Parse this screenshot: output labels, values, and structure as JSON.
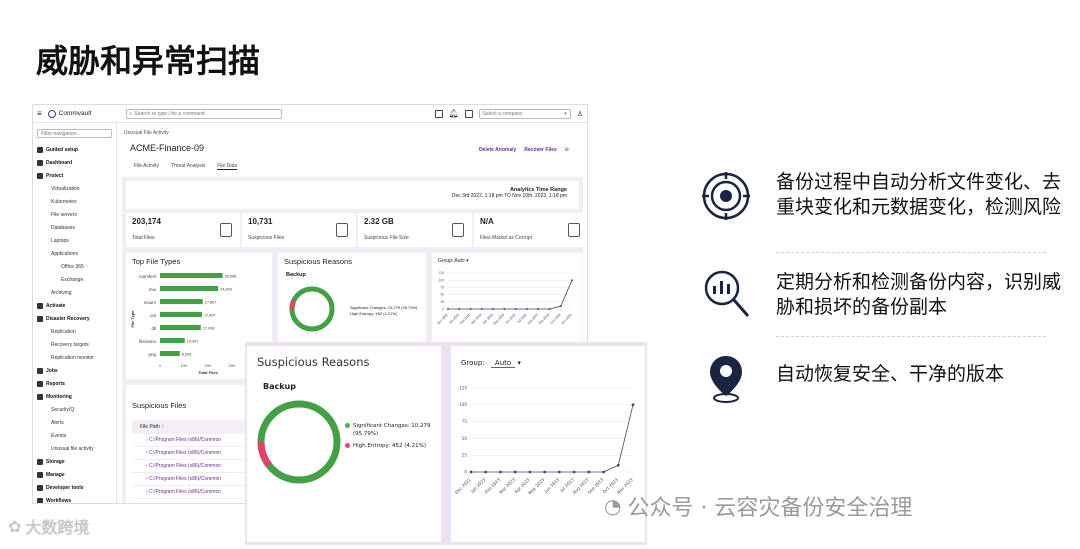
{
  "slide": {
    "title": "威胁和异常扫描"
  },
  "app": {
    "brand": "Commvault",
    "search_placeholder": "Search or type / for a command",
    "company_placeholder": "Select a company",
    "filter_placeholder": "Filter navigation...",
    "nav": [
      {
        "label": "Guided setup",
        "level": 0
      },
      {
        "label": "Dashboard",
        "level": 0
      },
      {
        "label": "Protect",
        "level": 0
      },
      {
        "label": "Virtualization",
        "level": 1
      },
      {
        "label": "Kubernetes",
        "level": 1
      },
      {
        "label": "File servers",
        "level": 1
      },
      {
        "label": "Databases",
        "level": 1
      },
      {
        "label": "Laptops",
        "level": 1
      },
      {
        "label": "Applications",
        "level": 1
      },
      {
        "label": "Office 365",
        "level": 2
      },
      {
        "label": "Exchange",
        "level": 2
      },
      {
        "label": "Archiving",
        "level": 1
      },
      {
        "label": "Activate",
        "level": 0
      },
      {
        "label": "Disaster Recovery",
        "level": 0
      },
      {
        "label": "Replication",
        "level": 1
      },
      {
        "label": "Recovery targets",
        "level": 1
      },
      {
        "label": "Replication monitor",
        "level": 1
      },
      {
        "label": "Jobs",
        "level": 0
      },
      {
        "label": "Reports",
        "level": 0
      },
      {
        "label": "Monitoring",
        "level": 0
      },
      {
        "label": "SecurityIQ",
        "level": 1
      },
      {
        "label": "Alerts",
        "level": 1
      },
      {
        "label": "Events",
        "level": 1
      },
      {
        "label": "Unusual file activity",
        "level": 1
      },
      {
        "label": "Storage",
        "level": 0
      },
      {
        "label": "Manage",
        "level": 0
      },
      {
        "label": "Developer tools",
        "level": 0
      },
      {
        "label": "Workflows",
        "level": 0
      }
    ],
    "breadcrumb": "Unusual File Activity",
    "host": "ACME-Finance-09",
    "actions": [
      "Delete Anomaly",
      "Recover Files"
    ],
    "tabs": [
      "File Activity",
      "Threat Analysis",
      "File Data"
    ],
    "analytics_title": "Analytics Time Range",
    "analytics_range": "Dec 3rd 2022, 1:18 pm TO Nov 10th, 2023, 1:18 pm",
    "stats": [
      {
        "value": "203,174",
        "label": "Total Files"
      },
      {
        "value": "10,731",
        "label": "Suspicious Files"
      },
      {
        "value": "2.32 GB",
        "label": "Suspicious File Size"
      },
      {
        "value": "N/A",
        "label": "Files Market as Corrupt"
      }
    ],
    "top_file_types": {
      "title": "Top File Types",
      "ylabel": "File Type",
      "xlabel": "Total Files",
      "types": [
        "manifest",
        "mui",
        "msum",
        "cat",
        "dll",
        "filenamo",
        "png"
      ],
      "values": [
        26096,
        24209,
        17807,
        17497,
        17008,
        10307,
        8243
      ],
      "labels": [
        "26,096",
        "24,209",
        "17,807",
        "17,497",
        "17,008",
        "10,307",
        "8,243"
      ],
      "ticks": [
        "0",
        "10K",
        "20K",
        "30K",
        "40K"
      ]
    },
    "suspicious_files": {
      "title": "Suspicious Files",
      "col": "File Path",
      "rows": [
        "C:/Program Files (x86)/Common",
        "C:/Program Files (x86)/Common",
        "C:/Program Files (x86)/Common",
        "C:/Program Files (x86)/Common",
        "C:/Program Files (x86)/Common"
      ]
    }
  },
  "overlay": {
    "reasons_title": "Suspicious Reasons",
    "backup": "Backup",
    "legend": [
      {
        "label": "Significant Changes: 10,279 (95.79%)",
        "color": "#4caf50"
      },
      {
        "label": "High Entropy: 452 (4.21%)",
        "color": "#e0446a"
      }
    ],
    "group_label": "Group:",
    "group_value": "Auto",
    "line_dates": [
      "Dec 2022",
      "Jan 2023",
      "Feb 2023",
      "Mar 2023",
      "Apr 2023",
      "May 2023",
      "Jun 2023",
      "Jul 2023",
      "Aug 2023",
      "Sep 2023",
      "Oct 2023",
      "Nov 2023"
    ],
    "line_yticks": [
      "0",
      "25",
      "50",
      "75",
      "100",
      "125"
    ]
  },
  "chart_data": [
    {
      "type": "bar",
      "title": "Top File Types",
      "categories": [
        "manifest",
        "mui",
        "msum",
        "cat",
        "dll",
        "filenamo",
        "png"
      ],
      "values": [
        26096,
        24209,
        17807,
        17497,
        17008,
        10307,
        8243
      ],
      "xlabel": "Total Files",
      "ylabel": "File Type"
    },
    {
      "type": "pie",
      "title": "Suspicious Reasons",
      "categories": [
        "Significant Changes",
        "High Entropy"
      ],
      "values": [
        10279,
        452
      ]
    },
    {
      "type": "line",
      "x": [
        "Dec 2022",
        "Jan 2023",
        "Feb 2023",
        "Mar 2023",
        "Apr 2023",
        "May 2023",
        "Jun 2023",
        "Jul 2023",
        "Aug 2023",
        "Sep 2023",
        "Oct 2023",
        "Nov 2023"
      ],
      "values": [
        0,
        0,
        0,
        0,
        0,
        0,
        0,
        0,
        0,
        0,
        10,
        100
      ],
      "ylim": [
        0,
        125
      ]
    }
  ],
  "bullets": [
    {
      "text": "备份过程中自动分析文件变化、去重块变化和元数据变化，检测风险",
      "icon": "scan-target-icon"
    },
    {
      "text": "定期分析和检测备份内容，识别威胁和损坏的备份副本",
      "icon": "magnifier-analysis-icon"
    },
    {
      "text": "自动恢复安全、干净的版本",
      "icon": "location-pin-icon"
    }
  ],
  "watermark": "公众号 · 云容灾备份安全治理",
  "watermark_bl": "大数跨境"
}
